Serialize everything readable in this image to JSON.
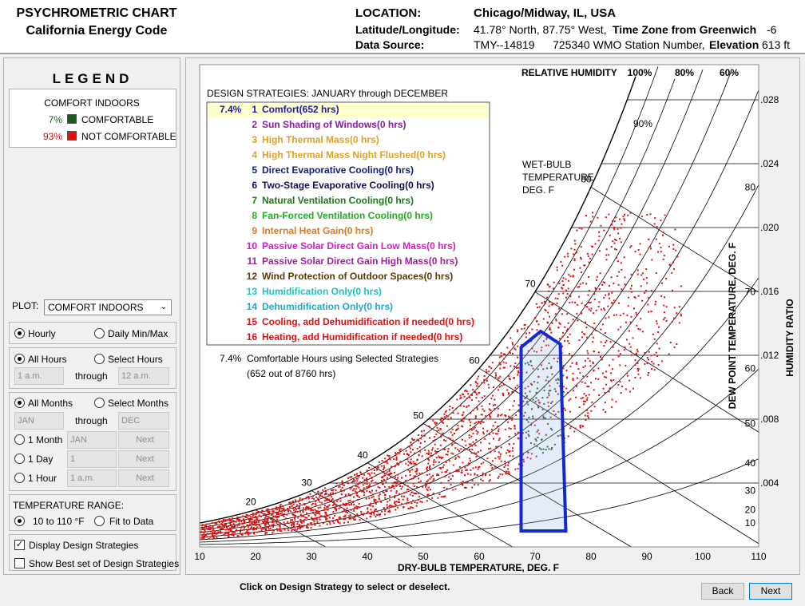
{
  "header": {
    "title_line1": "PSYCHROMETRIC CHART",
    "title_line2": "California Energy Code",
    "location_label": "LOCATION:",
    "location_value": "Chicago/Midway, IL, USA",
    "latlon_label": "Latitude/Longitude:",
    "latlon_value": "41.78° North, 87.75° West,",
    "timezone_label": "Time Zone from Greenwich",
    "timezone_value": "-6",
    "source_label": "Data Source:",
    "source_value": "TMY--14819",
    "wmo_value": "725340 WMO Station Number,",
    "elevation_label": "Elevation",
    "elevation_value": "613 ft"
  },
  "legend": {
    "title": "LEGEND",
    "heading": "COMFORT INDOORS",
    "items": [
      {
        "pct": "7%",
        "label": "COMFORTABLE",
        "color": "#1e5a1e",
        "pct_color": "#1e5a1e"
      },
      {
        "pct": "93%",
        "label": "NOT COMFORTABLE",
        "color": "#e01010",
        "pct_color": "#d01010"
      }
    ]
  },
  "controls": {
    "plot_label": "PLOT:",
    "plot_value": "COMFORT INDOORS",
    "hourly": "Hourly",
    "daily": "Daily Min/Max",
    "all_hours": "All Hours",
    "select_hours": "Select Hours",
    "hour_from": "1 a.m.",
    "hour_through": "through",
    "hour_to": "12 a.m.",
    "all_months": "All Months",
    "select_months": "Select Months",
    "month_from": "JAN",
    "month_through": "through",
    "month_to": "DEC",
    "one_month": "1 Month",
    "one_month_value": "JAN",
    "one_day": "1 Day",
    "one_day_value": "1",
    "one_hour": "1 Hour",
    "one_hour_value": "1 a.m.",
    "next_small": "Next",
    "temp_range_label": "TEMPERATURE RANGE:",
    "range_10_110": "10 to 110 °F",
    "fit_to_data": "Fit to Data",
    "display_strategies": "Display Design Strategies",
    "show_best": "Show Best set of Design Strategies"
  },
  "strategies": {
    "heading": "DESIGN STRATEGIES:  JANUARY through DECEMBER",
    "items": [
      {
        "pct": "7.4%",
        "num": "1",
        "label": "Comfort(652 hrs)",
        "color": "#1a1aa6",
        "selected": true
      },
      {
        "pct": "",
        "num": "2",
        "label": "Sun Shading of Windows(0 hrs)",
        "color": "#8a1aa6",
        "selected": false
      },
      {
        "pct": "",
        "num": "3",
        "label": "High Thermal Mass(0 hrs)",
        "color": "#e0a020",
        "selected": false
      },
      {
        "pct": "",
        "num": "4",
        "label": "High Thermal Mass Night Flushed(0 hrs)",
        "color": "#e0a020",
        "selected": false
      },
      {
        "pct": "",
        "num": "5",
        "label": "Direct Evaporative Cooling(0 hrs)",
        "color": "#10207a",
        "selected": false
      },
      {
        "pct": "",
        "num": "6",
        "label": "Two-Stage Evaporative Cooling(0 hrs)",
        "color": "#101050",
        "selected": false
      },
      {
        "pct": "",
        "num": "7",
        "label": "Natural Ventilation Cooling(0 hrs)",
        "color": "#1a7a1a",
        "selected": false
      },
      {
        "pct": "",
        "num": "8",
        "label": "Fan-Forced Ventilation Cooling(0 hrs)",
        "color": "#22aa22",
        "selected": false
      },
      {
        "pct": "",
        "num": "9",
        "label": "Internal Heat Gain(0 hrs)",
        "color": "#d87a20",
        "selected": false
      },
      {
        "pct": "",
        "num": "10",
        "label": "Passive Solar Direct Gain Low Mass(0 hrs)",
        "color": "#d020c0",
        "selected": false
      },
      {
        "pct": "",
        "num": "11",
        "label": "Passive Solar Direct Gain High Mass(0 hrs)",
        "color": "#a020a0",
        "selected": false
      },
      {
        "pct": "",
        "num": "12",
        "label": "Wind Protection of Outdoor Spaces(0 hrs)",
        "color": "#5a3a00",
        "selected": false
      },
      {
        "pct": "",
        "num": "13",
        "label": "Humidification Only(0 hrs)",
        "color": "#20c0c0",
        "selected": false
      },
      {
        "pct": "",
        "num": "14",
        "label": "Dehumidification Only(0 hrs)",
        "color": "#20a8d0",
        "selected": false
      },
      {
        "pct": "",
        "num": "15",
        "label": "Cooling, add Dehumidification if needed(0 hrs)",
        "color": "#e01010",
        "selected": false
      },
      {
        "pct": "",
        "num": "16",
        "label": "Heating, add Humidification if needed(0 hrs)",
        "color": "#e01010",
        "selected": false
      }
    ],
    "summary_pct": "7.4%",
    "summary_line1": "Comfortable Hours using Selected Strategies",
    "summary_line2": "(652 out of 8760 hrs)"
  },
  "chart": {
    "rh_title": "RELATIVE HUMIDITY",
    "rh_labels": [
      {
        "rh": 100,
        "text": "100%"
      },
      {
        "rh": 80,
        "text": "80%"
      },
      {
        "rh": 60,
        "text": "60%"
      }
    ],
    "rh_90_label": "90%",
    "wb_title": [
      "WET-BULB",
      "TEMPERATURE",
      "DEG. F"
    ],
    "xlabel": "DRY-BULB TEMPERATURE, DEG. F",
    "ylabel_left": "DEW POINT TEMPERATURE, DEG. F",
    "ylabel_right": "HUMIDITY RATIO",
    "x_ticks": [
      10,
      20,
      30,
      40,
      50,
      60,
      70,
      80,
      90,
      100,
      110
    ],
    "w_ticks": [
      {
        "w": 0.004,
        "text": ".004"
      },
      {
        "w": 0.008,
        "text": ".008"
      },
      {
        "w": 0.012,
        "text": ".012"
      },
      {
        "w": 0.016,
        "text": ".016"
      },
      {
        "w": 0.02,
        "text": ".020"
      },
      {
        "w": 0.024,
        "text": ".024"
      },
      {
        "w": 0.028,
        "text": ".028"
      }
    ],
    "dp_labels": [
      10,
      20,
      30,
      40,
      50,
      60,
      70,
      80
    ],
    "wb_labels": [
      20,
      30,
      40,
      50,
      60,
      70,
      80
    ],
    "comfort_zone_color": "#1428d0",
    "not_comfortable_color": "#e01010",
    "comfortable_color": "#1e5a1e"
  },
  "footer": {
    "hint": "Click on Design Strategy to select or deselect.",
    "back": "Back",
    "next": "Next"
  }
}
